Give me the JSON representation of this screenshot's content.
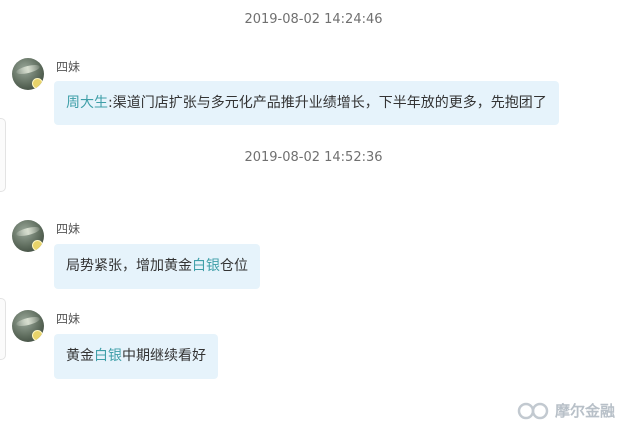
{
  "timestamps": [
    "2019-08-02 14:24:46",
    "2019-08-02 14:52:36"
  ],
  "messages": [
    {
      "sender": "四妹",
      "parts": [
        {
          "text": "周大生",
          "highlight": true
        },
        {
          "text": ":渠道门店扩张与多元化产品推升业绩增长，下半年放的更多，先抱团了",
          "highlight": false
        }
      ]
    },
    {
      "sender": "四妹",
      "parts": [
        {
          "text": "局势紧张，增加黄金",
          "highlight": false
        },
        {
          "text": "白银",
          "highlight": true
        },
        {
          "text": "仓位",
          "highlight": false
        }
      ]
    },
    {
      "sender": "四妹",
      "parts": [
        {
          "text": "黄金",
          "highlight": false
        },
        {
          "text": "白银",
          "highlight": true
        },
        {
          "text": "中期继续看好",
          "highlight": false
        }
      ]
    }
  ],
  "watermark": {
    "text": "摩尔金融",
    "icon": "logo-icon"
  },
  "colors": {
    "bubble": "#e6f3fb",
    "highlight": "#3f9fa8",
    "timestamp": "#707070"
  }
}
